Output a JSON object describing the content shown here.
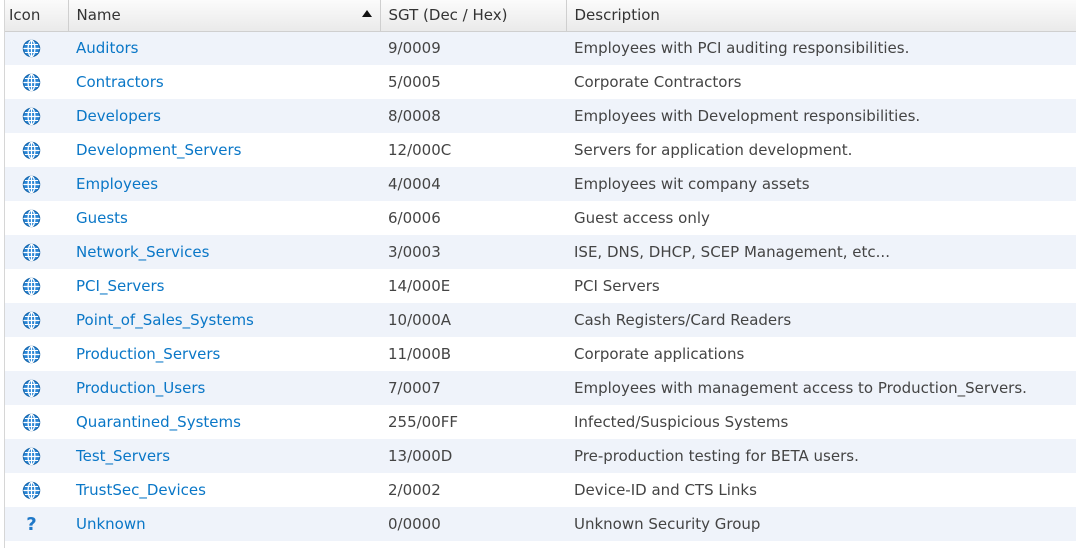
{
  "columns": {
    "icon": "Icon",
    "name": "Name",
    "sgt": "SGT (Dec / Hex)",
    "description": "Description"
  },
  "sort": {
    "column": "name",
    "direction": "ascending"
  },
  "colors": {
    "link": "#0a77c7",
    "row_alt": "#eff3fa",
    "globe": "#1f78c8"
  },
  "rows": [
    {
      "icon": "globe-icon",
      "name": "Auditors",
      "sgt": "9/0009",
      "description": "Employees with PCI auditing responsibilities."
    },
    {
      "icon": "globe-icon",
      "name": "Contractors",
      "sgt": "5/0005",
      "description": "Corporate Contractors"
    },
    {
      "icon": "globe-icon",
      "name": "Developers",
      "sgt": "8/0008",
      "description": "Employees with Development responsibilities."
    },
    {
      "icon": "globe-icon",
      "name": "Development_Servers",
      "sgt": "12/000C",
      "description": "Servers for application development."
    },
    {
      "icon": "globe-icon",
      "name": "Employees",
      "sgt": "4/0004",
      "description": "Employees wit company assets"
    },
    {
      "icon": "globe-icon",
      "name": "Guests",
      "sgt": "6/0006",
      "description": "Guest access only"
    },
    {
      "icon": "globe-icon",
      "name": "Network_Services",
      "sgt": "3/0003",
      "description": "ISE, DNS, DHCP, SCEP Management, etc..."
    },
    {
      "icon": "globe-icon",
      "name": "PCI_Servers",
      "sgt": "14/000E",
      "description": "PCI Servers"
    },
    {
      "icon": "globe-icon",
      "name": "Point_of_Sales_Systems",
      "sgt": "10/000A",
      "description": "Cash Registers/Card Readers"
    },
    {
      "icon": "globe-icon",
      "name": "Production_Servers",
      "sgt": "11/000B",
      "description": "Corporate applications"
    },
    {
      "icon": "globe-icon",
      "name": "Production_Users",
      "sgt": "7/0007",
      "description": "Employees with management access to Production_Servers."
    },
    {
      "icon": "globe-icon",
      "name": "Quarantined_Systems",
      "sgt": "255/00FF",
      "description": "Infected/Suspicious Systems"
    },
    {
      "icon": "globe-icon",
      "name": "Test_Servers",
      "sgt": "13/000D",
      "description": "Pre-production testing for BETA users."
    },
    {
      "icon": "globe-icon",
      "name": "TrustSec_Devices",
      "sgt": "2/0002",
      "description": "Device-ID and CTS Links"
    },
    {
      "icon": "question-mark-icon",
      "name": "Unknown",
      "sgt": "0/0000",
      "description": "Unknown Security Group"
    }
  ]
}
